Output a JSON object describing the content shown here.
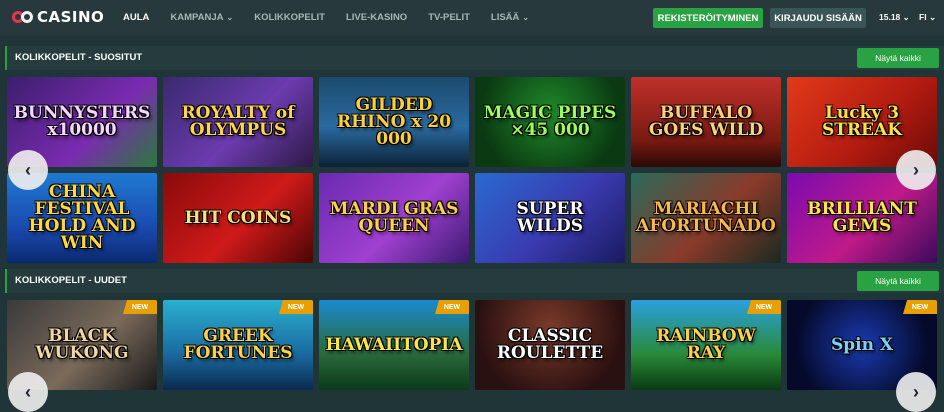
{
  "header": {
    "logo_text": "CASINO",
    "nav": [
      {
        "label": "AULA",
        "dropdown": false,
        "active": true
      },
      {
        "label": "KAMPANJA",
        "dropdown": true,
        "active": false
      },
      {
        "label": "KOLIKKOPELIT",
        "dropdown": false,
        "active": false
      },
      {
        "label": "LIVE-KASINO",
        "dropdown": false,
        "active": false
      },
      {
        "label": "TV-PELIT",
        "dropdown": false,
        "active": false
      },
      {
        "label": "LISÄÄ",
        "dropdown": true,
        "active": false
      }
    ],
    "register_label": "REKISTERÖITYMINEN",
    "login_label": "KIRJAUDU SISÄÄN",
    "time": "15.18",
    "language": "FI"
  },
  "colors": {
    "accent": "#29a244",
    "badge": "#e8a000",
    "logo_red": "#e8354a"
  },
  "sections": [
    {
      "title": "KOLIKKOPELIT - SUOSITUT",
      "show_all_label": "Näytä kaikki",
      "games": [
        {
          "name": "BUNNYSTERS x10000",
          "badge": ""
        },
        {
          "name": "ROYALTY of OLYMPUS",
          "badge": ""
        },
        {
          "name": "GILDED RHINO x 20 000",
          "badge": ""
        },
        {
          "name": "MAGIC PIPES ×45 000",
          "badge": ""
        },
        {
          "name": "BUFFALO GOES WILD",
          "badge": ""
        },
        {
          "name": "Lucky 3 STREAK",
          "badge": ""
        },
        {
          "name": "CHINA FESTIVAL HOLD AND WIN",
          "badge": ""
        },
        {
          "name": "HIT COINS",
          "badge": ""
        },
        {
          "name": "MARDI GRAS QUEEN",
          "badge": ""
        },
        {
          "name": "SUPER WILDS",
          "badge": ""
        },
        {
          "name": "MARIACHI AFORTUNADO",
          "badge": ""
        },
        {
          "name": "BRILLIANT GEMS",
          "badge": ""
        }
      ]
    },
    {
      "title": "KOLIKKOPELIT - UUDET",
      "show_all_label": "Näytä kaikki",
      "games": [
        {
          "name": "BLACK WUKONG",
          "badge": "NEW"
        },
        {
          "name": "GREEK FORTUNES",
          "badge": "NEW"
        },
        {
          "name": "HAWAIITOPIA",
          "badge": "NEW"
        },
        {
          "name": "CLASSIC ROULETTE",
          "badge": ""
        },
        {
          "name": "RAINBOW RAY",
          "badge": "NEW"
        },
        {
          "name": "Spin X",
          "badge": "NEW"
        }
      ]
    }
  ],
  "icons": {
    "prev": "chevron-left-icon",
    "next": "chevron-right-icon"
  }
}
